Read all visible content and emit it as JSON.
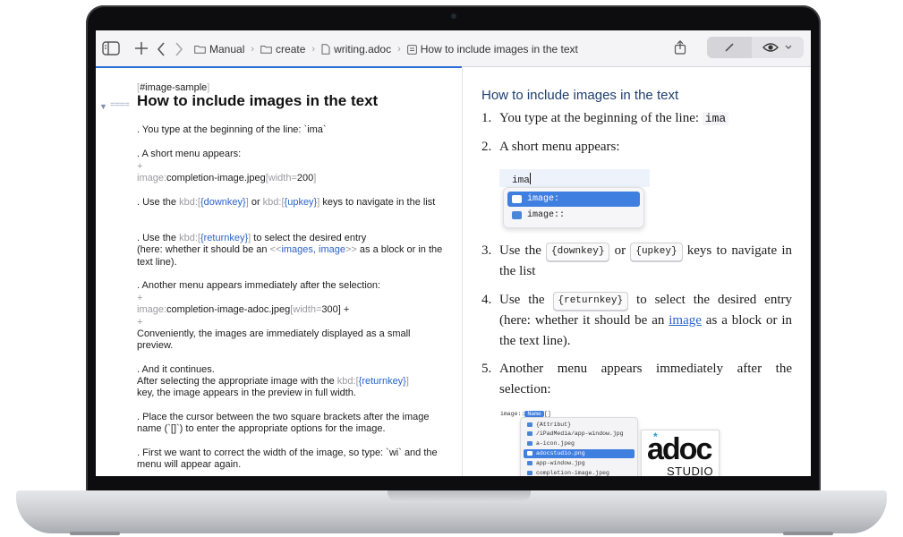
{
  "toolbar": {
    "breadcrumbs": [
      "Manual",
      "create",
      "writing.adoc",
      "How to include images in the text"
    ]
  },
  "editor": {
    "anchor": "#image-sample",
    "heading_marker": "====",
    "heading": "How to include images in the text",
    "l1": ". You type at the beginning of the line: `ima`",
    "l2": ". A short menu appears:",
    "plus": "+",
    "l3_macro": "image:",
    "l3_file": "completion-image.jpeg",
    "l3_attr": "[width=",
    "l3_val": "200",
    "l3_close": "]",
    "l4_a": ". Use the ",
    "kbd": "kbd:[",
    "downkey": "{downkey}",
    "kbd_close": "]",
    "l4_or": " or ",
    "upkey": "{upkey}",
    "l4_b": " keys to navigate in the list",
    "l5_a": ". Use the ",
    "returnkey": "{returnkey}",
    "l5_b": " to select the desired entry",
    "l5_c": "(here: whether it should be an ",
    "xref_open": "<<",
    "xref_text": "images, image",
    "xref_close": ">>",
    "l5_d": " as a block or in the text line).",
    "l6": ". Another menu appears immediately after the selection:",
    "l7_file": "completion-image-adoc.jpeg",
    "l7_val": "300",
    "l7_end": "] +",
    "l8": "Conveniently, the images are immediately displayed as a small preview.",
    "l9": ". And it continues.",
    "l10_a": "After selecting the appropriate image with the ",
    "l10_b": "key, the image appears in the preview in full width.",
    "l11": ". Place the cursor between the two square brackets after the image name (`[]`) to enter the appropriate options for the image.",
    "l12": ". First we want to correct the width of the image, so type: `wi` and the menu will appear again."
  },
  "preview": {
    "title": "How to include images in the text",
    "n1": "1.",
    "i1": "You type at the beginning of the line: ",
    "i1_code": "ima",
    "n2": "2.",
    "i2": "A short menu appears:",
    "n3": "3.",
    "i3_a": "Use the ",
    "i3_k1": "{downkey}",
    "i3_or": " or ",
    "i3_k2": "{upkey}",
    "i3_b": " keys to navigate in the list",
    "n4": "4.",
    "i4_a": "Use the ",
    "i4_k": "{returnkey}",
    "i4_b": " to select the desired entry (here: whether it should be an ",
    "i4_link": "image",
    "i4_c": " as a block or in the text line).",
    "n5": "5.",
    "i5": "Another menu appears immediately after the selection:"
  },
  "completion1": {
    "typed": "ima",
    "options": [
      "image:",
      "image::"
    ]
  },
  "completion2": {
    "head_macro": "image::",
    "head_name": "Name",
    "head_brackets": "[]",
    "items": [
      "{Attribut}",
      "/iPadMedia/app-window.jpg",
      "a-icon.jpeg",
      "adocstudio.png",
      "app-window.jpg",
      "completion-image.jpeg"
    ],
    "logo_main": "adoc",
    "logo_sub": "STUDIO"
  },
  "colors": {
    "accent": "#2f6fd8",
    "link": "#2a64c8",
    "heading": "#1f3e6e"
  }
}
